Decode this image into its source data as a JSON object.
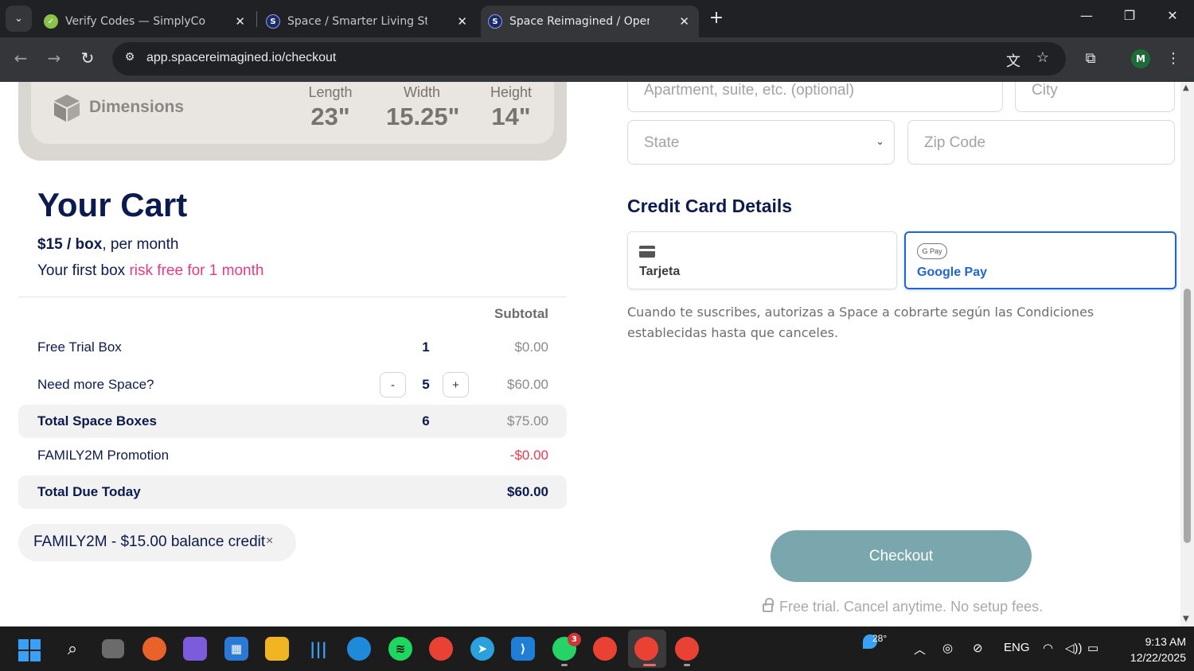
{
  "browser": {
    "tabs": [
      {
        "title": "Verify Codes — SimplyCodes",
        "favicon": "S"
      },
      {
        "title": "Space / Smarter Living Starts Here",
        "favicon": "S"
      },
      {
        "title": "Space Reimagined / Open the door",
        "favicon": "S"
      }
    ],
    "url": "app.spacereimagined.io/checkout",
    "profile_initial": "M"
  },
  "dimensions": {
    "label": "Dimensions",
    "length_label": "Length",
    "length": "23\"",
    "width_label": "Width",
    "width": "15.25\"",
    "height_label": "Height",
    "height": "14\""
  },
  "cart": {
    "title": "Your Cart",
    "price_bold": "$15 / box",
    "price_rest": ", per month",
    "trial_prefix": "Your first box ",
    "trial_highlight": "risk free for 1 month",
    "subtotal_header": "Subtotal",
    "rows": [
      {
        "name": "Free Trial Box",
        "qty": "1",
        "amount": "$0.00"
      },
      {
        "name": "Need more Space?",
        "qty": "5",
        "amount": "$60.00",
        "minus": "-",
        "plus": "+"
      },
      {
        "name": "Total Space Boxes",
        "qty": "6",
        "amount": "$75.00"
      },
      {
        "name": "FAMILY2M Promotion",
        "amount": "-$0.00"
      },
      {
        "name": "Total Due Today",
        "amount": "$60.00"
      }
    ],
    "promo_chip": "FAMILY2M - $15.00 balance credit",
    "promo_remove": "×"
  },
  "address": {
    "apartment_placeholder": "Apartment, suite, etc. (optional)",
    "city_placeholder": "City",
    "state_placeholder": "State",
    "zip_placeholder": "Zip Code"
  },
  "payment": {
    "title": "Credit Card Details",
    "card_label": "Tarjeta",
    "gpay_label": "Google Pay",
    "gpay_badge": "G Pay",
    "consent": "Cuando te suscribes, autorizas a Space a cobrarte según las Condiciones establecidas hasta que canceles.",
    "checkout": "Checkout",
    "fine_print": "Free trial. Cancel anytime. No setup fees."
  },
  "taskbar": {
    "weather": "28°",
    "lang": "ENG",
    "time": "9:13 AM",
    "date": "12/22/2025",
    "whatsapp_badge": "3"
  },
  "colors": {
    "navy": "#0c1b4f",
    "pink": "#e73a86",
    "checkout_bg": "#7aa7ae",
    "gpay_blue": "#1d66d9"
  }
}
